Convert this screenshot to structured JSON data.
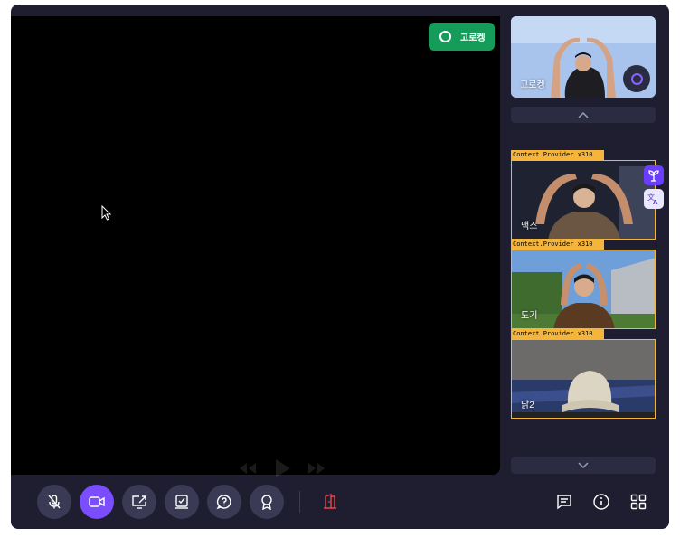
{
  "main_stage": {
    "presenter_badge": {
      "label": "고로켕",
      "icon": "circle-icon"
    }
  },
  "sidebar": {
    "self": {
      "name": "고로켕",
      "icon": "circle-ring-icon"
    },
    "scroll_up_icon": "chevron-up-icon",
    "scroll_down_icon": "chevron-down-icon",
    "participants": [
      {
        "debug_label": "Context.Provider x310",
        "name": "맥스"
      },
      {
        "debug_label": "Context.Provider x310",
        "name": "도기"
      },
      {
        "debug_label": "Context.Provider x310",
        "name": "닭2"
      }
    ],
    "floating_tools": [
      "plant-icon",
      "translate-icon"
    ]
  },
  "controls": {
    "buttons": [
      {
        "name": "mic-off-button",
        "icon": "mic-off-icon",
        "active": false
      },
      {
        "name": "camera-button",
        "icon": "video-camera-icon",
        "active": true
      },
      {
        "name": "screen-share-button",
        "icon": "screen-share-icon",
        "active": false
      },
      {
        "name": "whiteboard-button",
        "icon": "check-board-icon",
        "active": false
      },
      {
        "name": "question-button",
        "icon": "question-bubble-icon",
        "active": false
      },
      {
        "name": "award-button",
        "icon": "medal-icon",
        "active": false
      }
    ],
    "leave_icon": "exit-door-icon",
    "right": [
      "chat-icon",
      "info-icon",
      "grid-icon"
    ]
  },
  "colors": {
    "background": "#1e1e30",
    "accent": "#7a4dff",
    "presenter": "#159c5a",
    "leave": "#e5484d",
    "debug": "#f5b53b"
  }
}
